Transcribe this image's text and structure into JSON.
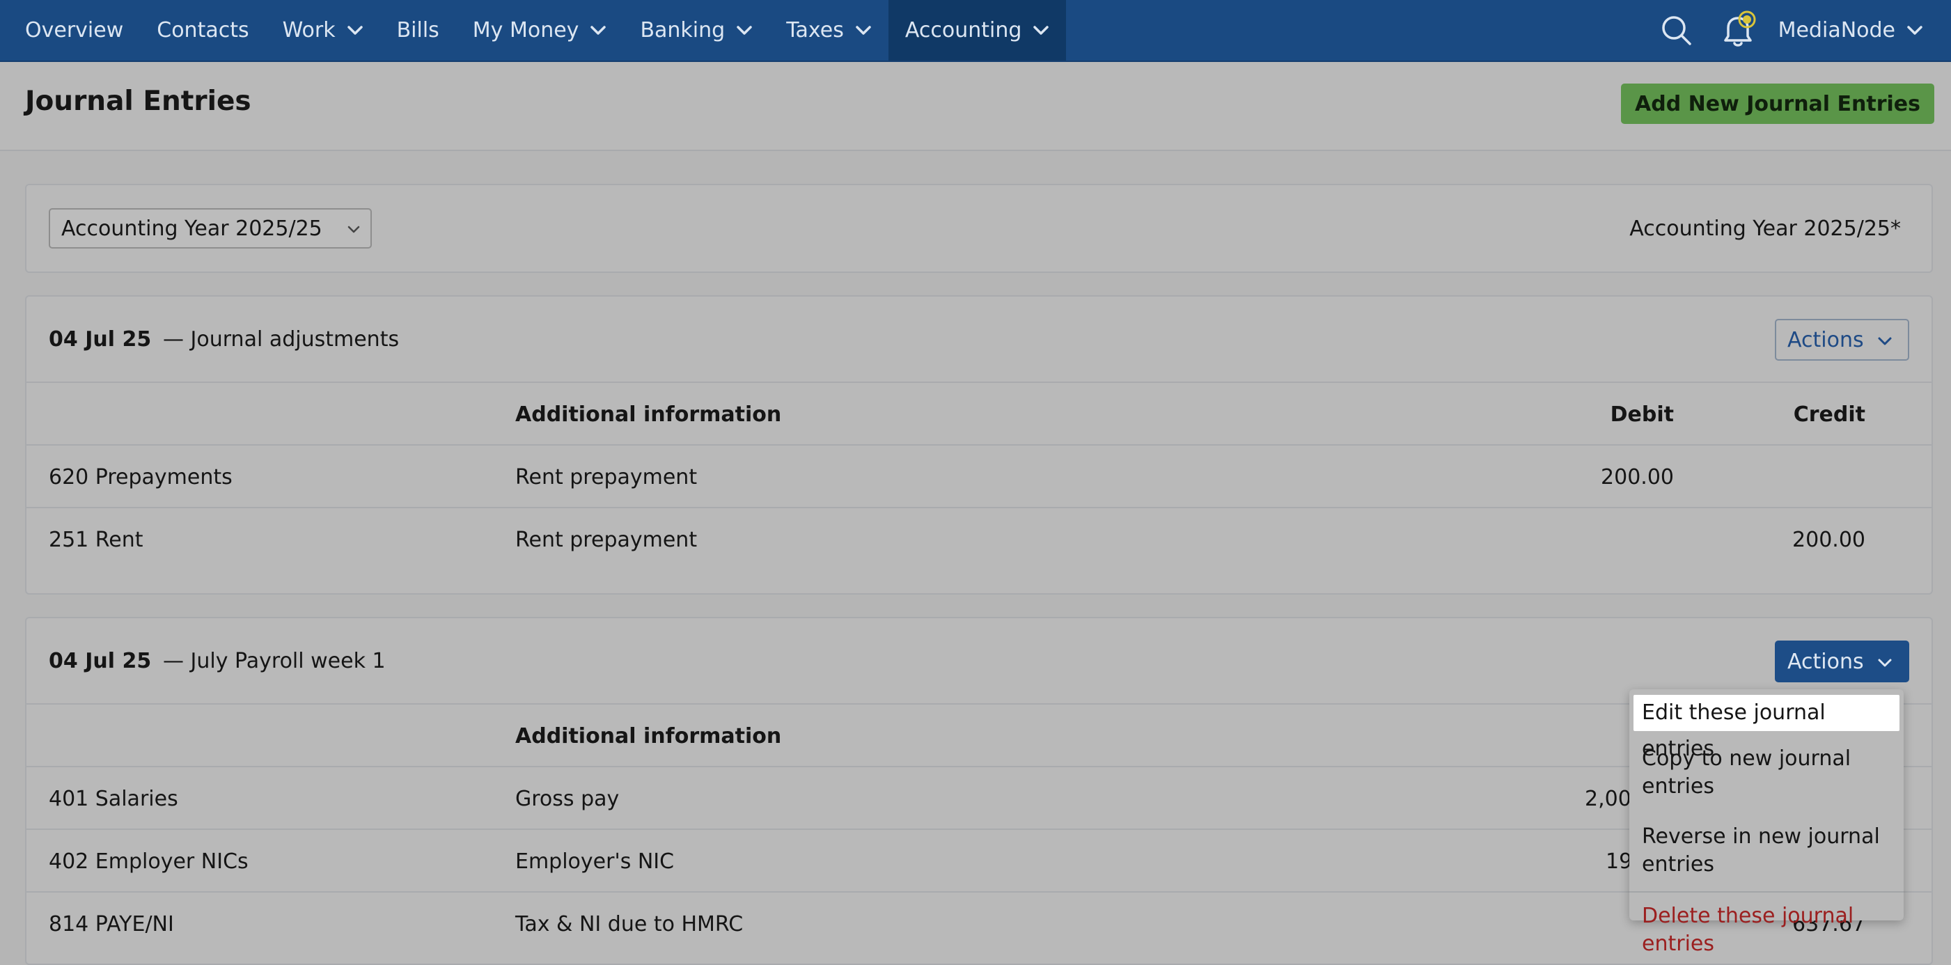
{
  "nav": {
    "items": [
      {
        "label": "Overview",
        "has_menu": false
      },
      {
        "label": "Contacts",
        "has_menu": false
      },
      {
        "label": "Work",
        "has_menu": true
      },
      {
        "label": "Bills",
        "has_menu": false
      },
      {
        "label": "My Money",
        "has_menu": true
      },
      {
        "label": "Banking",
        "has_menu": true
      },
      {
        "label": "Taxes",
        "has_menu": true
      },
      {
        "label": "Accounting",
        "has_menu": true,
        "active": true
      }
    ],
    "user_label": "MediaNode",
    "icons": [
      "search-icon",
      "notification-bell-icon",
      "chevron-down-icon"
    ]
  },
  "header": {
    "title": "Journal Entries",
    "add_button": "Add New Journal Entries"
  },
  "year_filter": {
    "selected": "Accounting Year 2025/25",
    "current_label": "Accounting Year 2025/25*"
  },
  "columns": {
    "info": "Additional information",
    "debit": "Debit",
    "credit": "Credit"
  },
  "entries": [
    {
      "date": "04 Jul 25",
      "description": "— Journal adjustments",
      "actions_label": "Actions",
      "rows": [
        {
          "account": "620 Prepayments",
          "info": "Rent prepayment",
          "debit": "200.00",
          "credit": ""
        },
        {
          "account": "251 Rent",
          "info": "Rent prepayment",
          "debit": "",
          "credit": "200.00"
        }
      ]
    },
    {
      "date": "04 Jul 25",
      "description": "— July Payroll week 1",
      "actions_label": "Actions",
      "header_debit_visible": "D",
      "rows": [
        {
          "account": "401 Salaries",
          "info": "Gross pay",
          "debit": "2,00",
          "credit": ""
        },
        {
          "account": "402 Employer NICs",
          "info": "Employer's NIC",
          "debit": "19",
          "credit": ""
        },
        {
          "account": "814 PAYE/NI",
          "info": "Tax & NI due to HMRC",
          "debit": "",
          "credit": "637.67"
        }
      ]
    }
  ],
  "actions_menu": {
    "items": [
      "Edit these journal entries",
      "Copy to new journal entries",
      "Reverse in new journal entries",
      "Delete these journal entries"
    ]
  },
  "colors": {
    "nav_bg": "#1a4a82",
    "nav_active": "#103966",
    "add_button": "#5a9548",
    "link_blue": "#1e4a85",
    "danger": "#9b1f1f",
    "bell_badge": "#d9c43a"
  }
}
